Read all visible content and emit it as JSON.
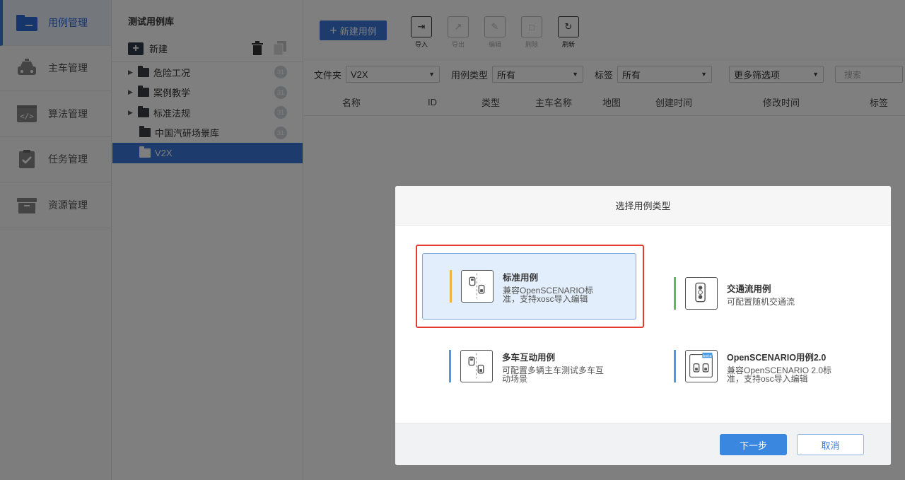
{
  "nav": {
    "items": [
      {
        "label": "用例管理",
        "icon": "folder-icon",
        "active": true
      },
      {
        "label": "主车管理",
        "icon": "car-icon",
        "active": false
      },
      {
        "label": "算法管理",
        "icon": "code-icon",
        "active": false
      },
      {
        "label": "任务管理",
        "icon": "clipboard-check-icon",
        "active": false
      },
      {
        "label": "资源管理",
        "icon": "archive-box-icon",
        "active": false
      }
    ]
  },
  "tree": {
    "title": "测试用例库",
    "new_label": "新建",
    "items": [
      {
        "label": "危险工况",
        "count": "31",
        "expandable": true
      },
      {
        "label": "案例教学",
        "count": "31",
        "expandable": true
      },
      {
        "label": "标准法规",
        "count": "31",
        "expandable": true
      },
      {
        "label": "中国汽研场景库",
        "count": "31",
        "expandable": false
      },
      {
        "label": "V2X",
        "count": "",
        "expandable": false,
        "selected": true
      }
    ]
  },
  "toolbar": {
    "new_case": "新建用例",
    "import": "导入",
    "export": "导出",
    "edit": "编辑",
    "delete": "删除",
    "refresh": "刷新"
  },
  "filters": {
    "folder_label": "文件夹",
    "folder_value": "V2X",
    "type_label": "用例类型",
    "type_value": "所有",
    "tag_label": "标签",
    "tag_value": "所有",
    "more_filters": "更多筛选项",
    "search_placeholder": "搜索"
  },
  "table": {
    "columns": [
      "名称",
      "ID",
      "类型",
      "主车名称",
      "地图",
      "创建时间",
      "修改时间",
      "标签"
    ]
  },
  "modal": {
    "title": "选择用例类型",
    "cards": [
      {
        "name": "标准用例",
        "desc_line1": "兼容OpenSCENARIO标",
        "desc_line2": "准，支持xosc导入编辑",
        "accent": "#f0b53a",
        "selected": true
      },
      {
        "name": "交通流用例",
        "desc_line1": "可配置随机交通流",
        "desc_line2": "",
        "accent": "#5cb85c",
        "selected": false
      },
      {
        "name": "多车互动用例",
        "desc_line1": "可配置多辆主车测试多车互",
        "desc_line2": "动场景",
        "accent": "#4a9be0",
        "selected": false
      },
      {
        "name": "OpenSCENARIO用例2.0",
        "desc_line1": "兼容OpenSCENARIO 2.0标",
        "desc_line2": "准，支持osc导入编辑",
        "accent": "#4a9be0",
        "selected": false,
        "badge": "beta"
      }
    ],
    "next_label": "下一步",
    "cancel_label": "取消"
  },
  "colors": {
    "accent_blue": "#3a77d8",
    "highlight_red": "#e53930"
  }
}
